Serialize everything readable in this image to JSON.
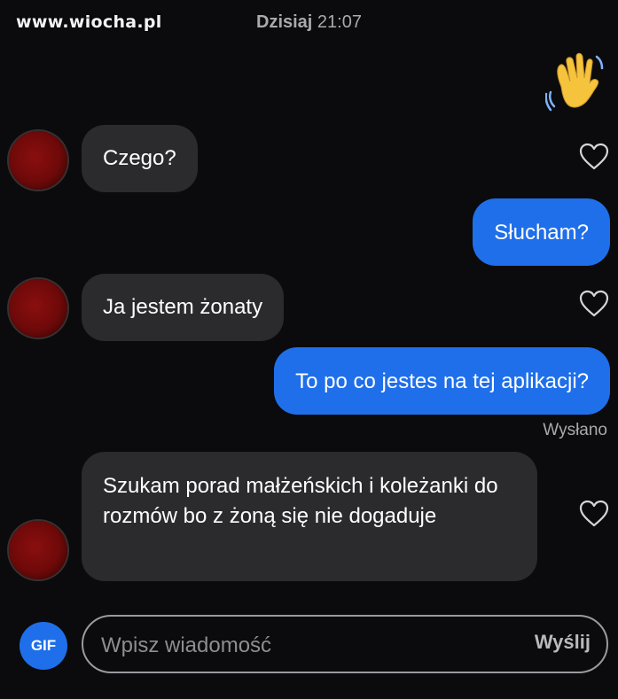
{
  "watermark": "www.wiocha.pl",
  "header": {
    "date": "Dzisiaj",
    "time": "21:07"
  },
  "messages": [
    {
      "side": "in",
      "text": "Czego?"
    },
    {
      "side": "out",
      "text": "Słucham?"
    },
    {
      "side": "in",
      "text": "Ja jestem żonaty"
    },
    {
      "side": "out",
      "text": "To po co jestes na tej aplikacji?"
    },
    {
      "side": "in",
      "text": "Szukam porad małżeńskich i koleżanki do rozmów bo z żoną się nie dogaduje"
    }
  ],
  "status": "Wysłano",
  "composer": {
    "gif_label": "GIF",
    "placeholder": "Wpisz wiadomość",
    "send_label": "Wyślij"
  },
  "icons": {
    "reaction": "waving-hand-icon",
    "like": "heart-outline-icon"
  },
  "colors": {
    "outgoing_bubble": "#1f6fea",
    "incoming_bubble": "#2b2b2e",
    "background": "#0b0b0d"
  }
}
